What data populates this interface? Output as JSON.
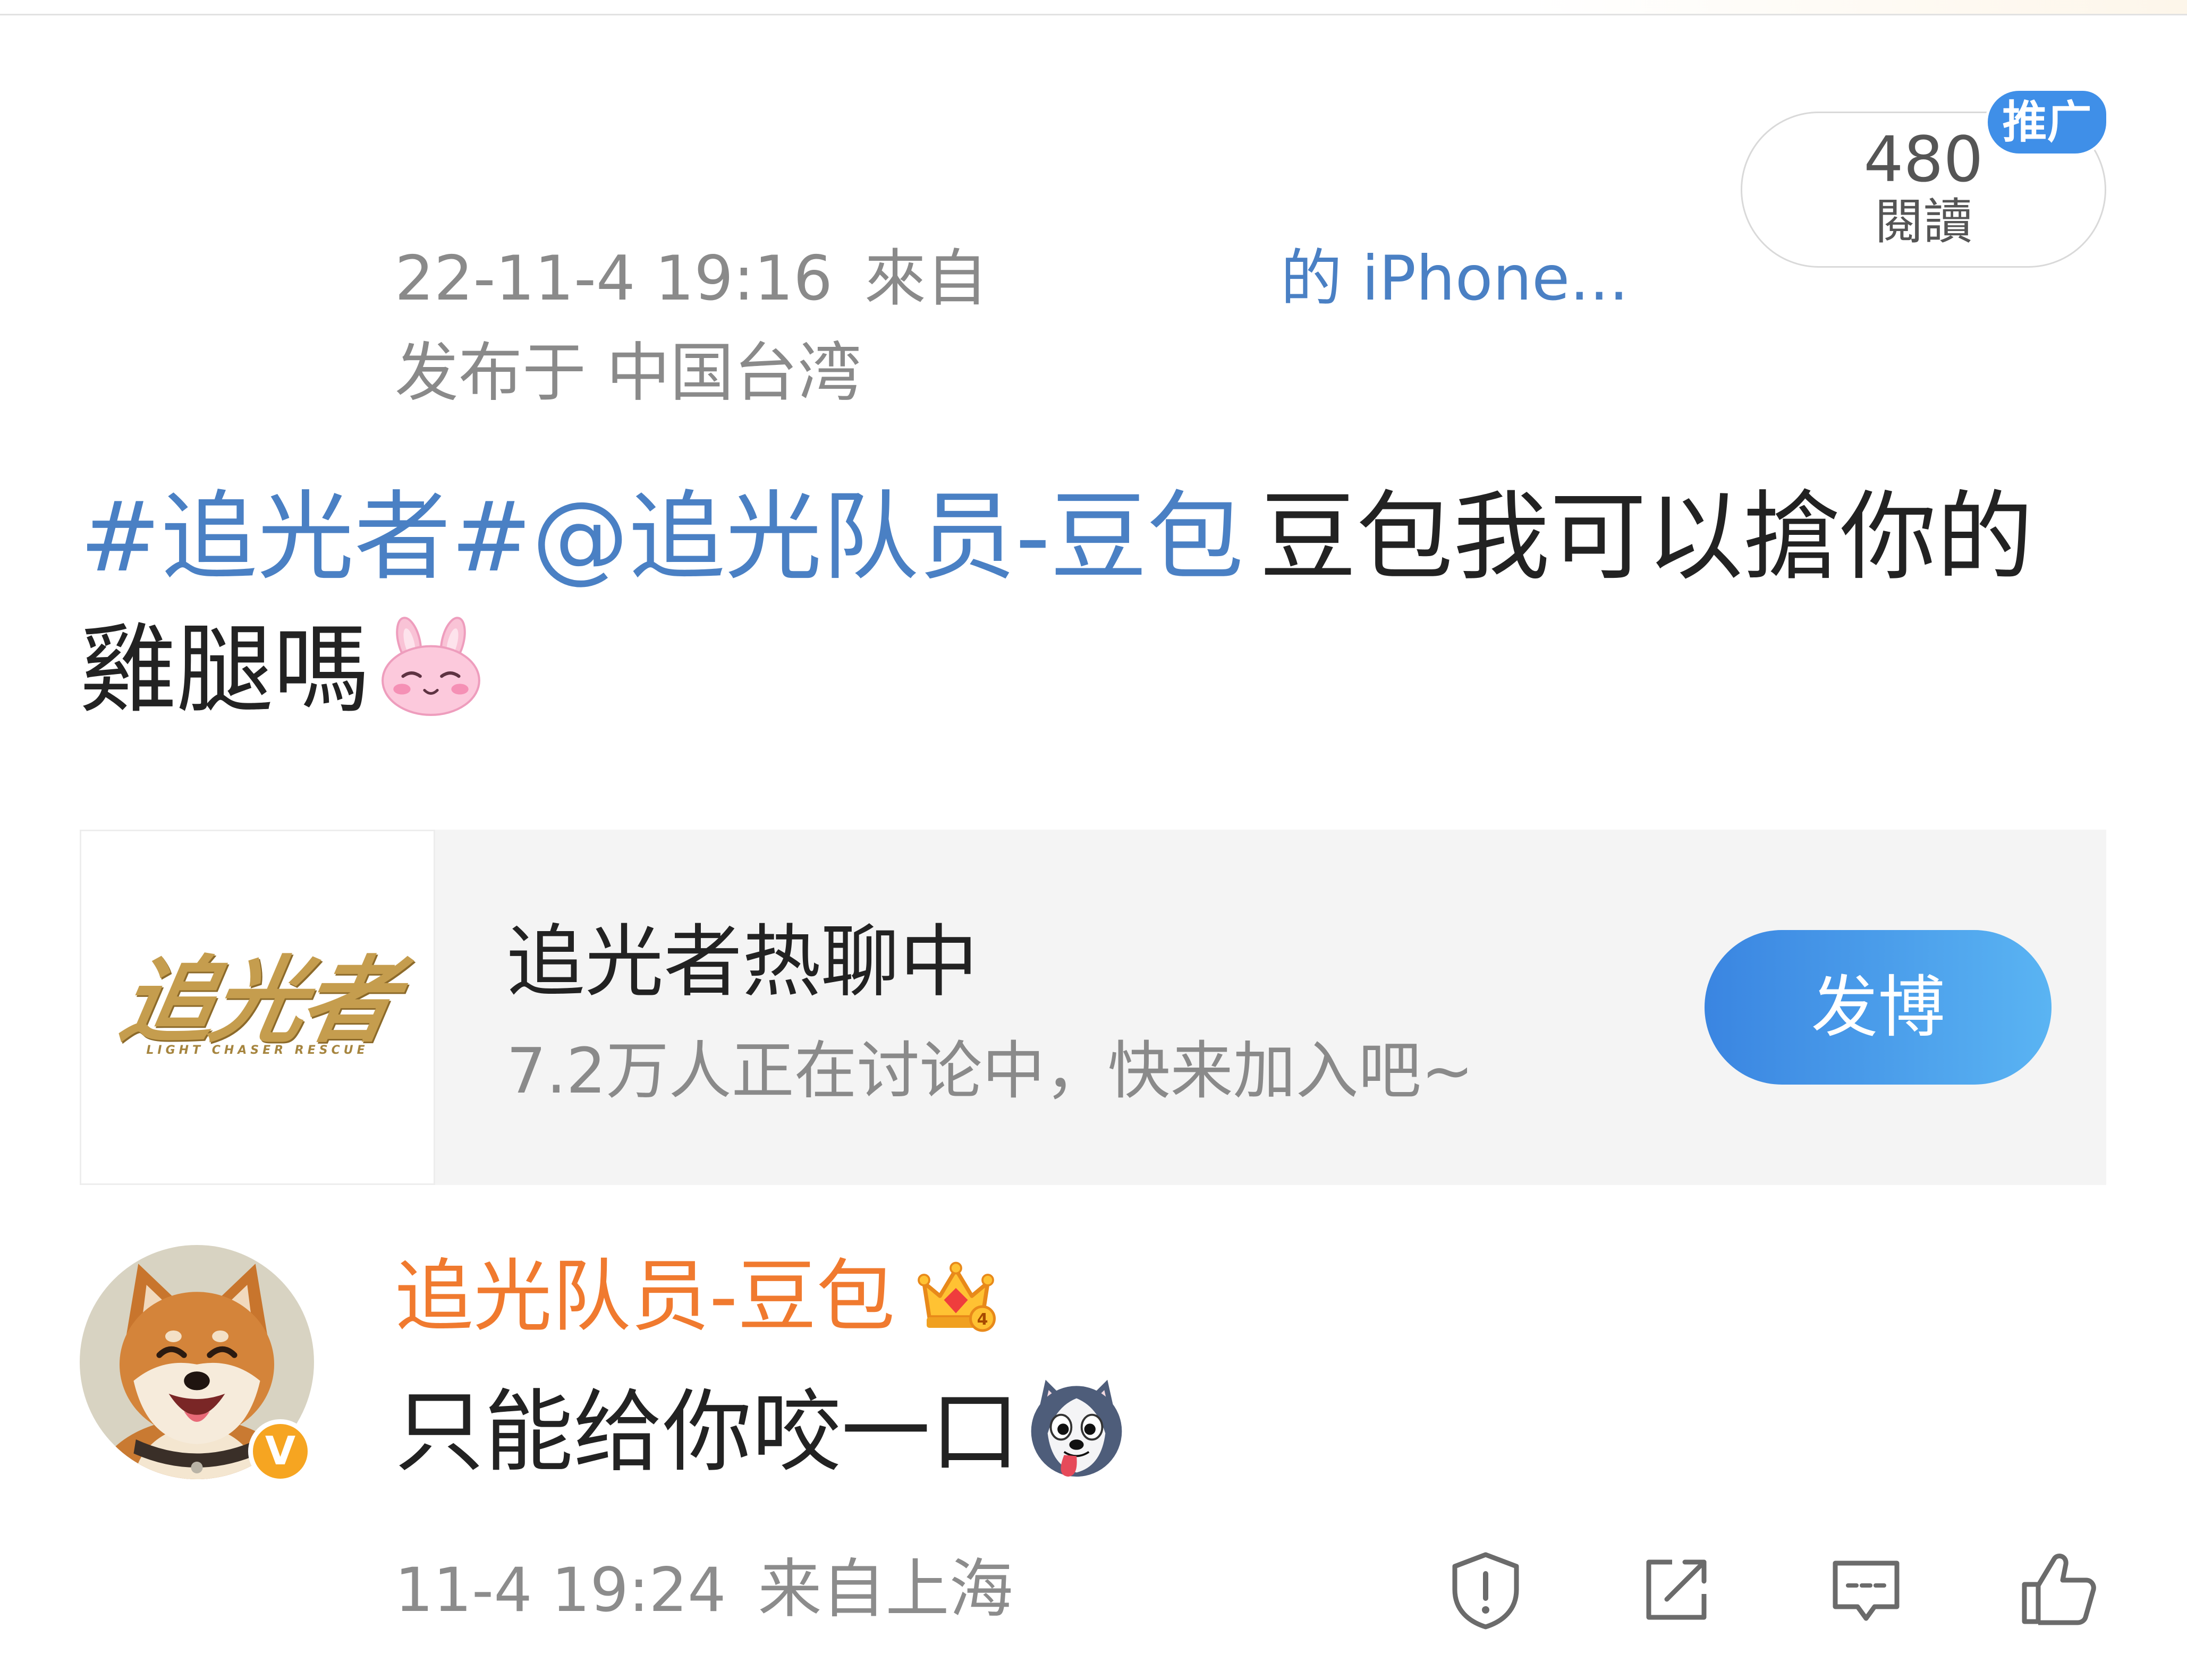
{
  "post": {
    "timestamp": "22-11-4 19:16",
    "source_prefix": "來自",
    "source_device": "的 iPhone...",
    "location": "发布于 中国台湾",
    "reads": {
      "count": "480",
      "label": "閱讀",
      "badge": "推广"
    },
    "text": {
      "topic": "#追光者#",
      "mention": "@追光队员-豆包",
      "body": "豆包我可以搶你的雞腿嗎",
      "emoji": "bunny-smile-emoji"
    }
  },
  "topic_card": {
    "logo_text": "追光者",
    "logo_subtext": "LIGHT CHASER RESCUE",
    "title": "追光者热聊中",
    "subtitle": "7.2万人正在讨论中，快来加入吧~",
    "button_label": "发博"
  },
  "comment": {
    "author": "追光队员-豆包",
    "verified_badge": "V",
    "crown_level": "4",
    "text": "只能给你咬一口",
    "emoji": "husky-emoji",
    "timestamp": "11-4 19:24",
    "location": "来自上海"
  },
  "actions": [
    "report-icon",
    "share-icon",
    "comment-icon",
    "like-icon"
  ],
  "colors": {
    "link": "#4a80c4",
    "author": "#f07a2f",
    "button": "#3a85e1",
    "badge": "#3f8fe8",
    "verified": "#f6a521",
    "muted": "#8a8a8a",
    "text": "#222222",
    "card_background": "#f4f4f4"
  }
}
